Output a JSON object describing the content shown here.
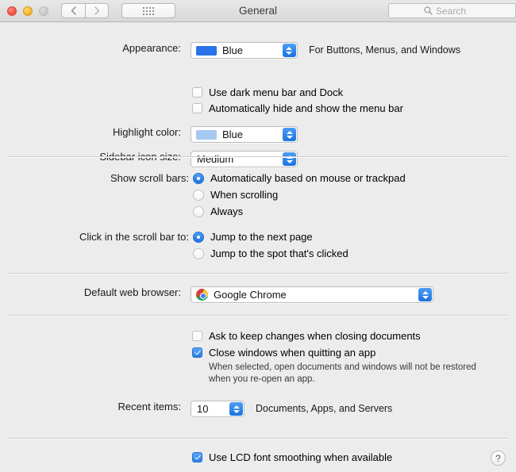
{
  "window": {
    "title": "General",
    "traffic_lights": [
      "close-red",
      "minimize-yellow",
      "zoom-disabled"
    ],
    "nav_back": "‹",
    "nav_forward": "›",
    "show_all_icon": "grid-icon"
  },
  "search": {
    "placeholder": "Search",
    "value": "",
    "icon": "search-icon"
  },
  "appearance": {
    "label": "Appearance:",
    "value": "Blue",
    "swatch_color": "#2a72e8",
    "hint": "For Buttons, Menus, and Windows",
    "dark_menu_bar": {
      "label": "Use dark menu bar and Dock",
      "checked": false
    },
    "auto_hide_menu_bar": {
      "label": "Automatically hide and show the menu bar",
      "checked": false
    }
  },
  "highlight_color": {
    "label": "Highlight color:",
    "value": "Blue",
    "swatch_color": "#a5c9f0"
  },
  "sidebar_icon_size": {
    "label": "Sidebar icon size:",
    "value": "Medium"
  },
  "scroll_bars": {
    "label": "Show scroll bars:",
    "options": [
      {
        "label": "Automatically based on mouse or trackpad",
        "selected": true
      },
      {
        "label": "When scrolling",
        "selected": false
      },
      {
        "label": "Always",
        "selected": false
      }
    ]
  },
  "click_scroll_bar": {
    "label": "Click in the scroll bar to:",
    "options": [
      {
        "label": "Jump to the next page",
        "selected": true
      },
      {
        "label": "Jump to the spot that's clicked",
        "selected": false
      }
    ]
  },
  "default_browser": {
    "label": "Default web browser:",
    "value": "Google Chrome",
    "icon": "chrome-icon"
  },
  "documents": {
    "ask_keep_changes": {
      "label": "Ask to keep changes when closing documents",
      "checked": false
    },
    "close_windows": {
      "label": "Close windows when quitting an app",
      "checked": true
    },
    "note_line1": "When selected, open documents and windows will not be restored",
    "note_line2": "when you re-open an app."
  },
  "recent_items": {
    "label": "Recent items:",
    "value": "10",
    "hint": "Documents, Apps, and Servers"
  },
  "font_smoothing": {
    "label": "Use LCD font smoothing when available",
    "checked": true
  },
  "help": {
    "label": "?"
  }
}
